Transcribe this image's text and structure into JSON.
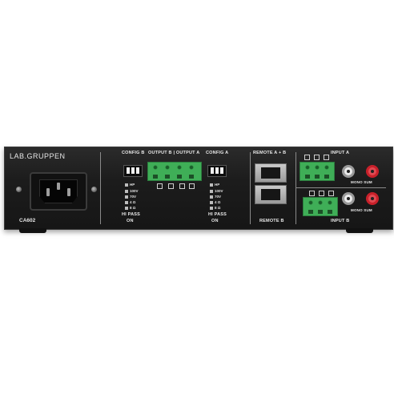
{
  "brand": "LAB.GRUPPEN",
  "model": "CA602",
  "labels": {
    "config_b": "CONFIG B",
    "output_b_a": "OUTPUT B | OUTPUT A",
    "config_a": "CONFIG A",
    "remote_ab": "REMOTE A + B",
    "remote_b": "REMOTE B",
    "input_a": "INPUT A",
    "input_b": "INPUT B",
    "mono_sum": "MONO SUM",
    "hi_pass": "HI PASS",
    "on": "ON"
  },
  "config_switch_labels": [
    "HP",
    "100V",
    "70V",
    "4 Ω",
    "8 Ω"
  ],
  "colors": {
    "panel": "#1c1c1c",
    "terminal_green": "#3fae57",
    "rca_red": "#c8202a",
    "rca_white": "#ececec"
  }
}
